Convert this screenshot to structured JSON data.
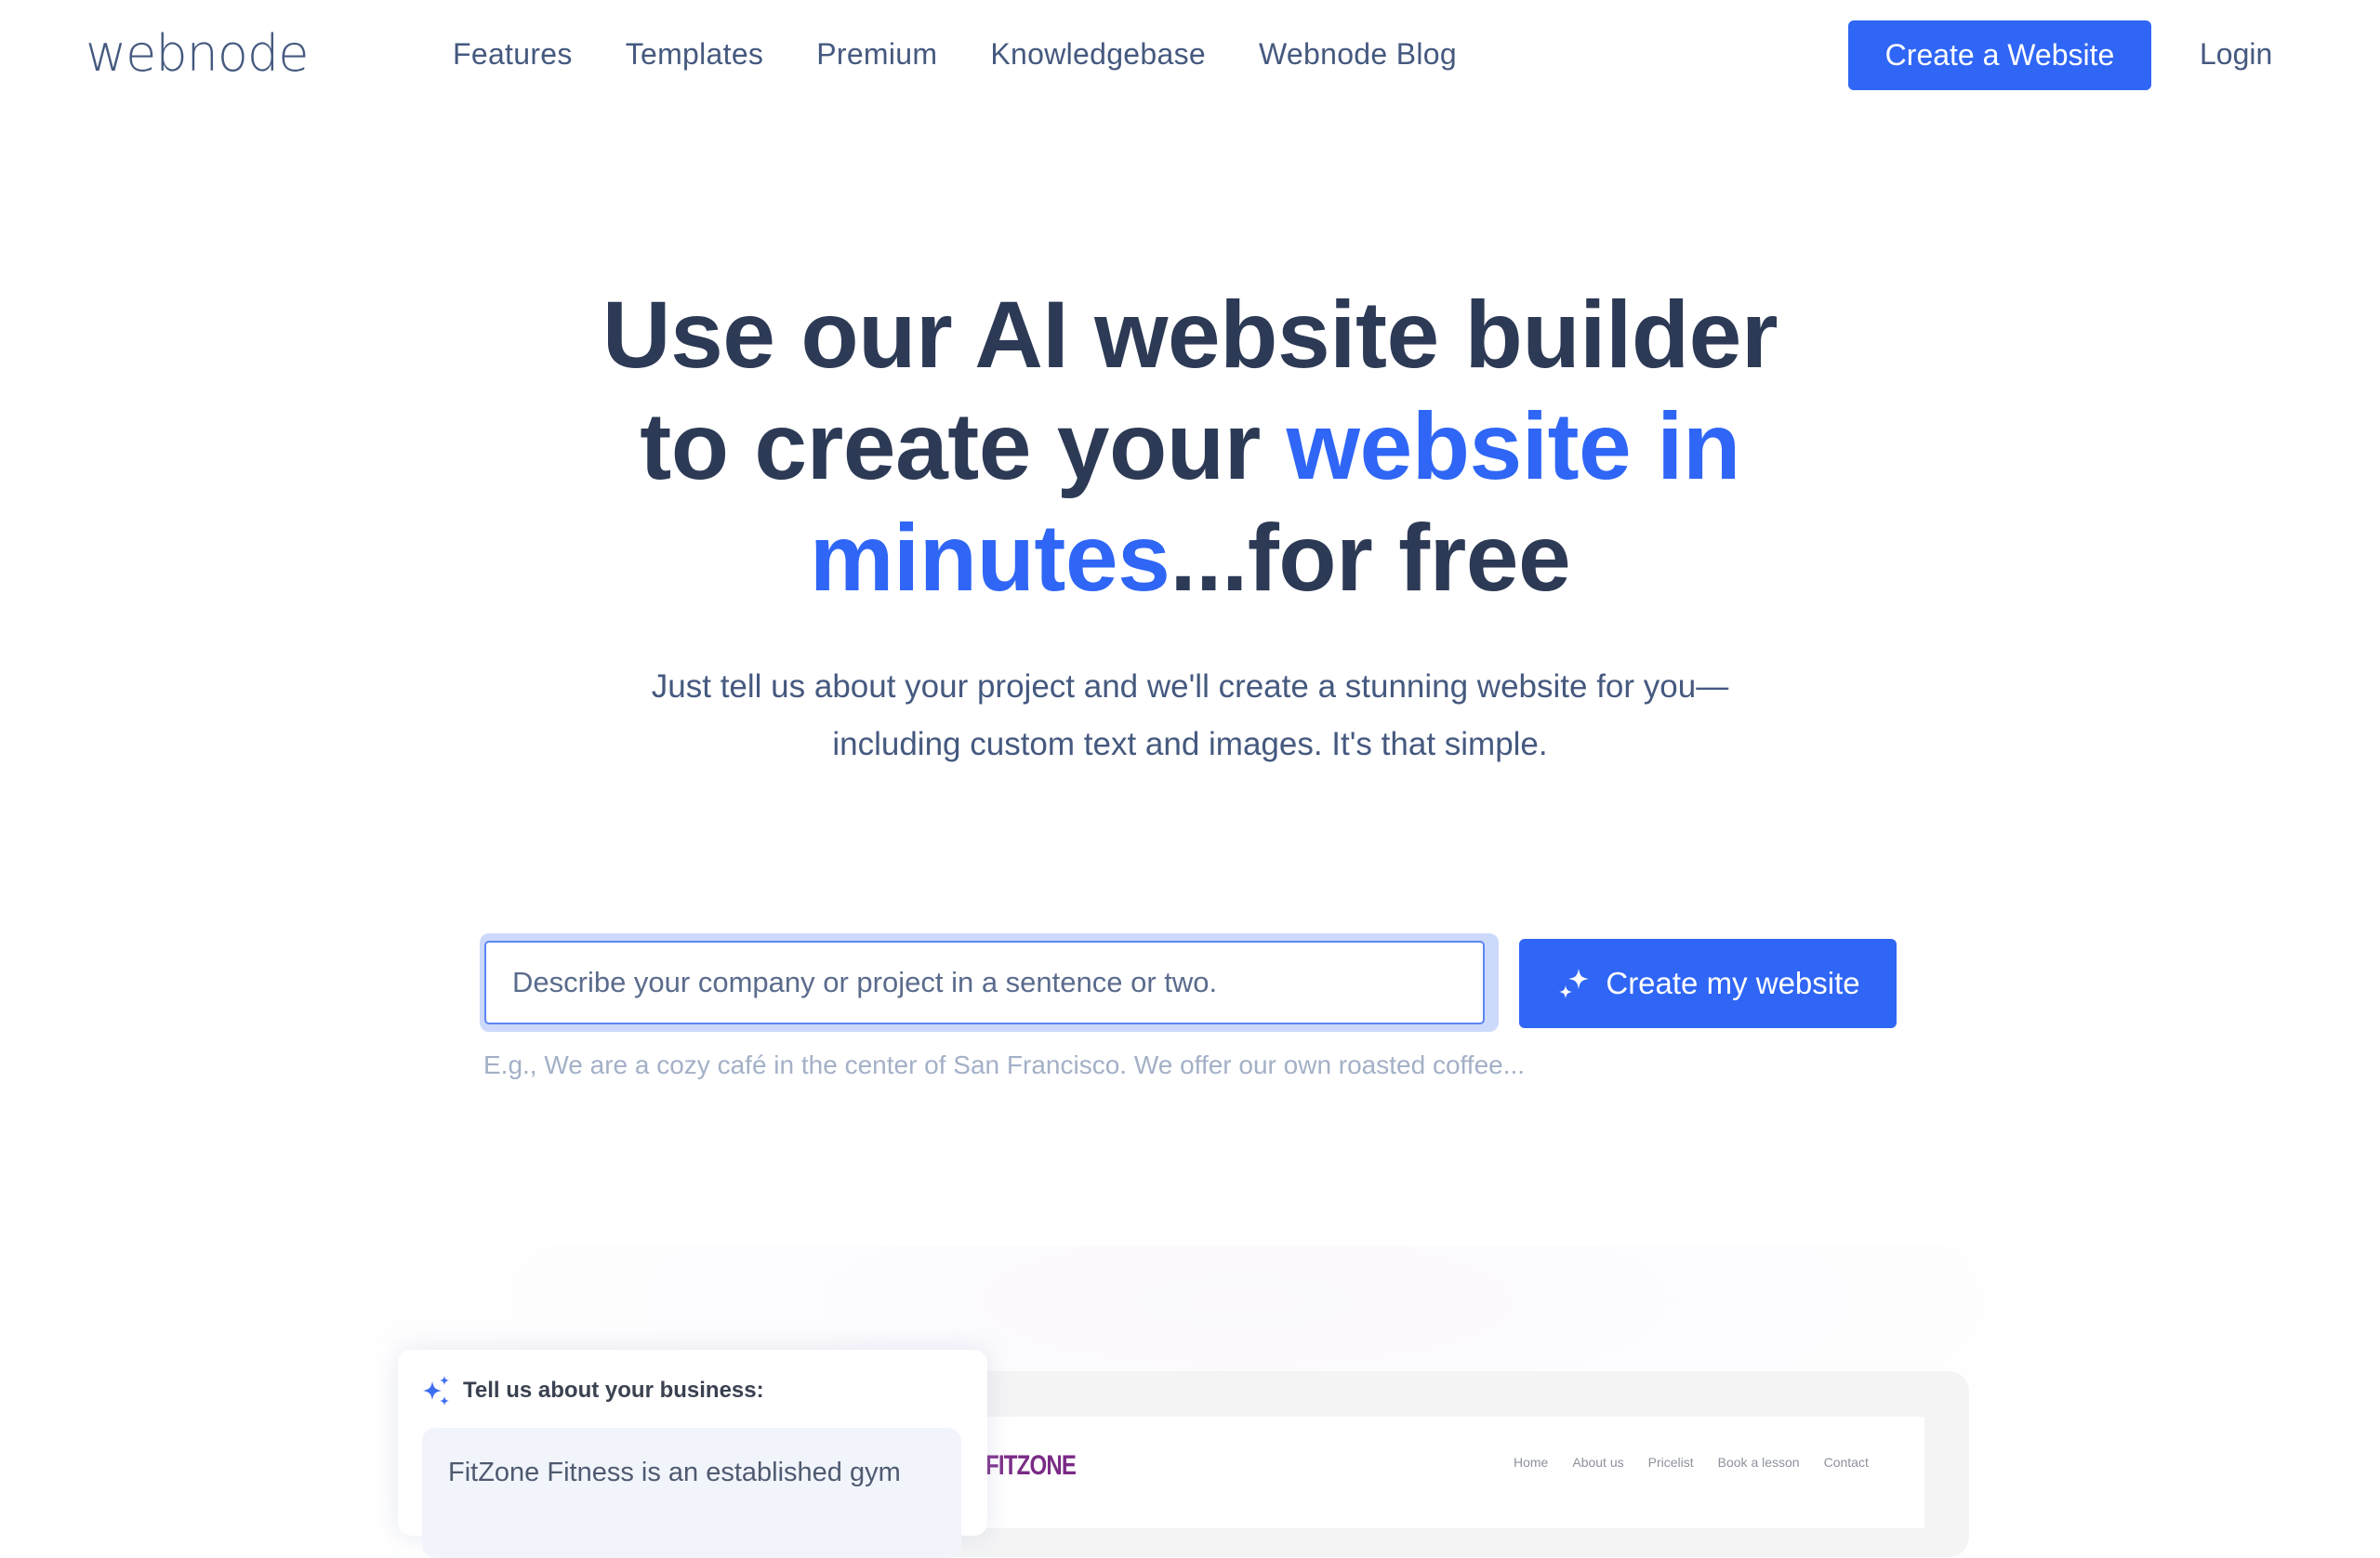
{
  "header": {
    "logo": "webnode",
    "nav": [
      "Features",
      "Templates",
      "Premium",
      "Knowledgebase",
      "Webnode Blog"
    ],
    "cta_label": "Create a Website",
    "login_label": "Login"
  },
  "hero": {
    "title_part1": "Use our AI website builder to create your ",
    "title_accent": "website in minutes",
    "title_part2": "...for free",
    "subtitle": "Just tell us about your project and we'll create a stunning website for you—including custom text and images. It's that simple."
  },
  "form": {
    "input_placeholder": "Describe your company or project in a sentence or two.",
    "input_value": "",
    "submit_label": "Create my website",
    "submit_icon": "sparkles-icon",
    "hint": "E.g., We are a cozy café in the center of San Francisco. We offer our own roasted coffee..."
  },
  "preview": {
    "chat_title": "Tell us about your business:",
    "chat_text": "FitZone Fitness is an established gym",
    "site_logo": "FITZONE",
    "site_nav": [
      "Home",
      "About us",
      "Pricelist",
      "Book a lesson",
      "Contact"
    ]
  },
  "colors": {
    "brand": "#2f66f5",
    "text": "#2d3a55",
    "nav_text": "#45597f",
    "hint": "#a3b0c6",
    "fitzone": "#7a2b86"
  }
}
